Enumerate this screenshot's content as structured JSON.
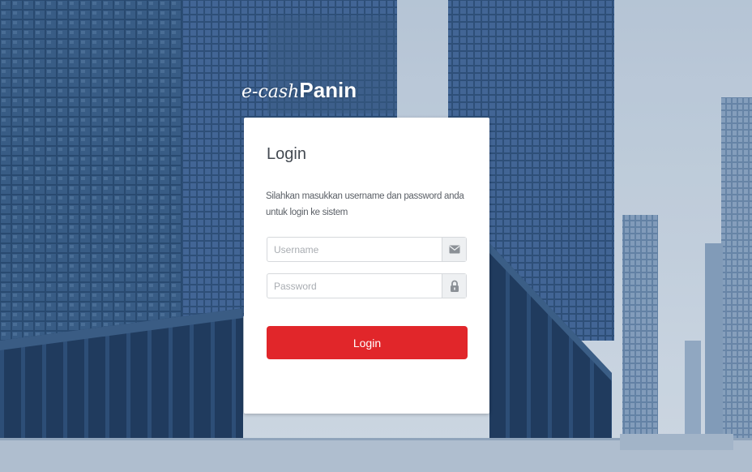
{
  "brand": {
    "logo_text": "e-cashPanin",
    "logo_prefix": "e-cash",
    "logo_suffix": "Panin"
  },
  "login_card": {
    "title": "Login",
    "description": "Silahkan masukkan username dan password anda untuk login ke sistem",
    "username": {
      "placeholder": "Username",
      "value": "",
      "icon": "envelope-icon"
    },
    "password": {
      "placeholder": "Password",
      "value": "",
      "icon": "lock-icon"
    },
    "submit_label": "Login"
  },
  "colors": {
    "primary_button": "#e1262a",
    "background_tint": "#2c4d73"
  }
}
